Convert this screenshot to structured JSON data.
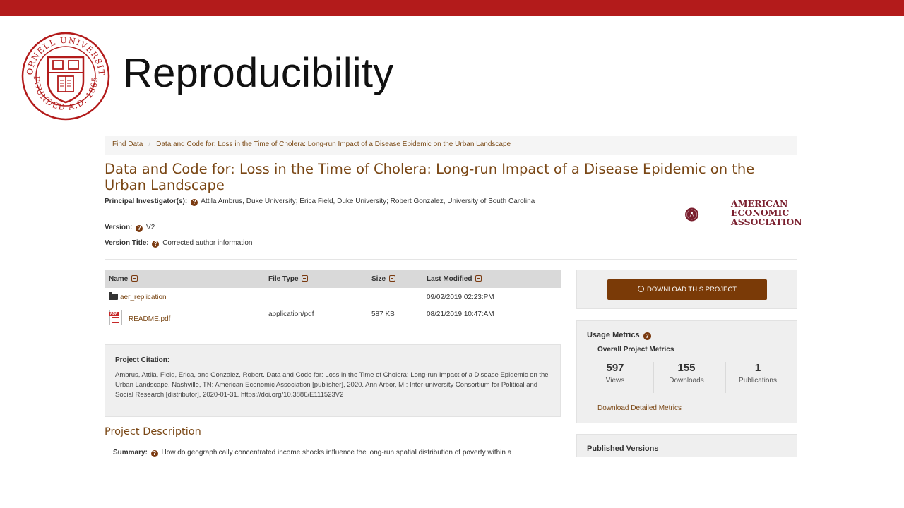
{
  "slide": {
    "title": "Reproducibility",
    "seal_text_top": "CORNELL UNIVERSITY",
    "seal_text_bottom": "FOUNDED A.D. 1865",
    "bar_color": "#b31b1b"
  },
  "breadcrumb": {
    "items": [
      "Find Data",
      "Data and Code for: Loss in the Time of Cholera: Long-run Impact of a Disease Epidemic on the Urban Landscape"
    ]
  },
  "project": {
    "title": "Data and Code for: Loss in the Time of Cholera: Long-run Impact of a Disease Epidemic on the Urban Landscape",
    "pi_label": "Principal Investigator(s):",
    "pi_value": "Attila Ambrus, Duke University; Erica Field, Duke University; Robert Gonzalez, University of South Carolina",
    "version_label": "Version:",
    "version_value": "V2",
    "version_title_label": "Version Title:",
    "version_title_value": "Corrected author information"
  },
  "publisher_logo": {
    "line1": "AMERICAN",
    "line2": "ECONOMIC",
    "line3": "ASSOCIATION",
    "color": "#7a1f2e"
  },
  "files_table": {
    "headers": [
      "Name",
      "File Type",
      "Size",
      "Last Modified"
    ],
    "rows": [
      {
        "name": "aer_replication",
        "icon": "folder-icon",
        "type": "",
        "size": "",
        "modified": "09/02/2019 02:23:PM"
      },
      {
        "name": "README.pdf",
        "icon": "pdf-icon",
        "type": "application/pdf",
        "size": "587 KB",
        "modified": "08/21/2019 10:47:AM"
      }
    ]
  },
  "citation": {
    "heading": "Project Citation:",
    "text": "Ambrus, Attila, Field, Erica, and Gonzalez, Robert. Data and Code for: Loss in the Time of Cholera: Long-run Impact of a Disease Epidemic on the Urban Landscape. Nashville, TN: American Economic Association [publisher], 2020. Ann Arbor, MI: Inter-university Consortium for Political and Social Research [distributor], 2020-01-31. https://doi.org/10.3886/E111523V2"
  },
  "description": {
    "heading": "Project Description",
    "summary_label": "Summary:",
    "summary_text": "How do geographically concentrated income shocks influence the long-run spatial distribution of poverty within a"
  },
  "sidebar": {
    "download_label": "DOWNLOAD THIS PROJECT",
    "usage_title": "Usage Metrics",
    "usage_subtitle": "Overall Project Metrics",
    "metrics": [
      {
        "value": "597",
        "label": "Views"
      },
      {
        "value": "155",
        "label": "Downloads"
      },
      {
        "value": "1",
        "label": "Publications"
      }
    ],
    "metrics_link": "Download Detailed Metrics",
    "published_versions_title": "Published Versions"
  },
  "colors": {
    "accent_brown": "#7a4715",
    "button_brown": "#7a3a07"
  }
}
